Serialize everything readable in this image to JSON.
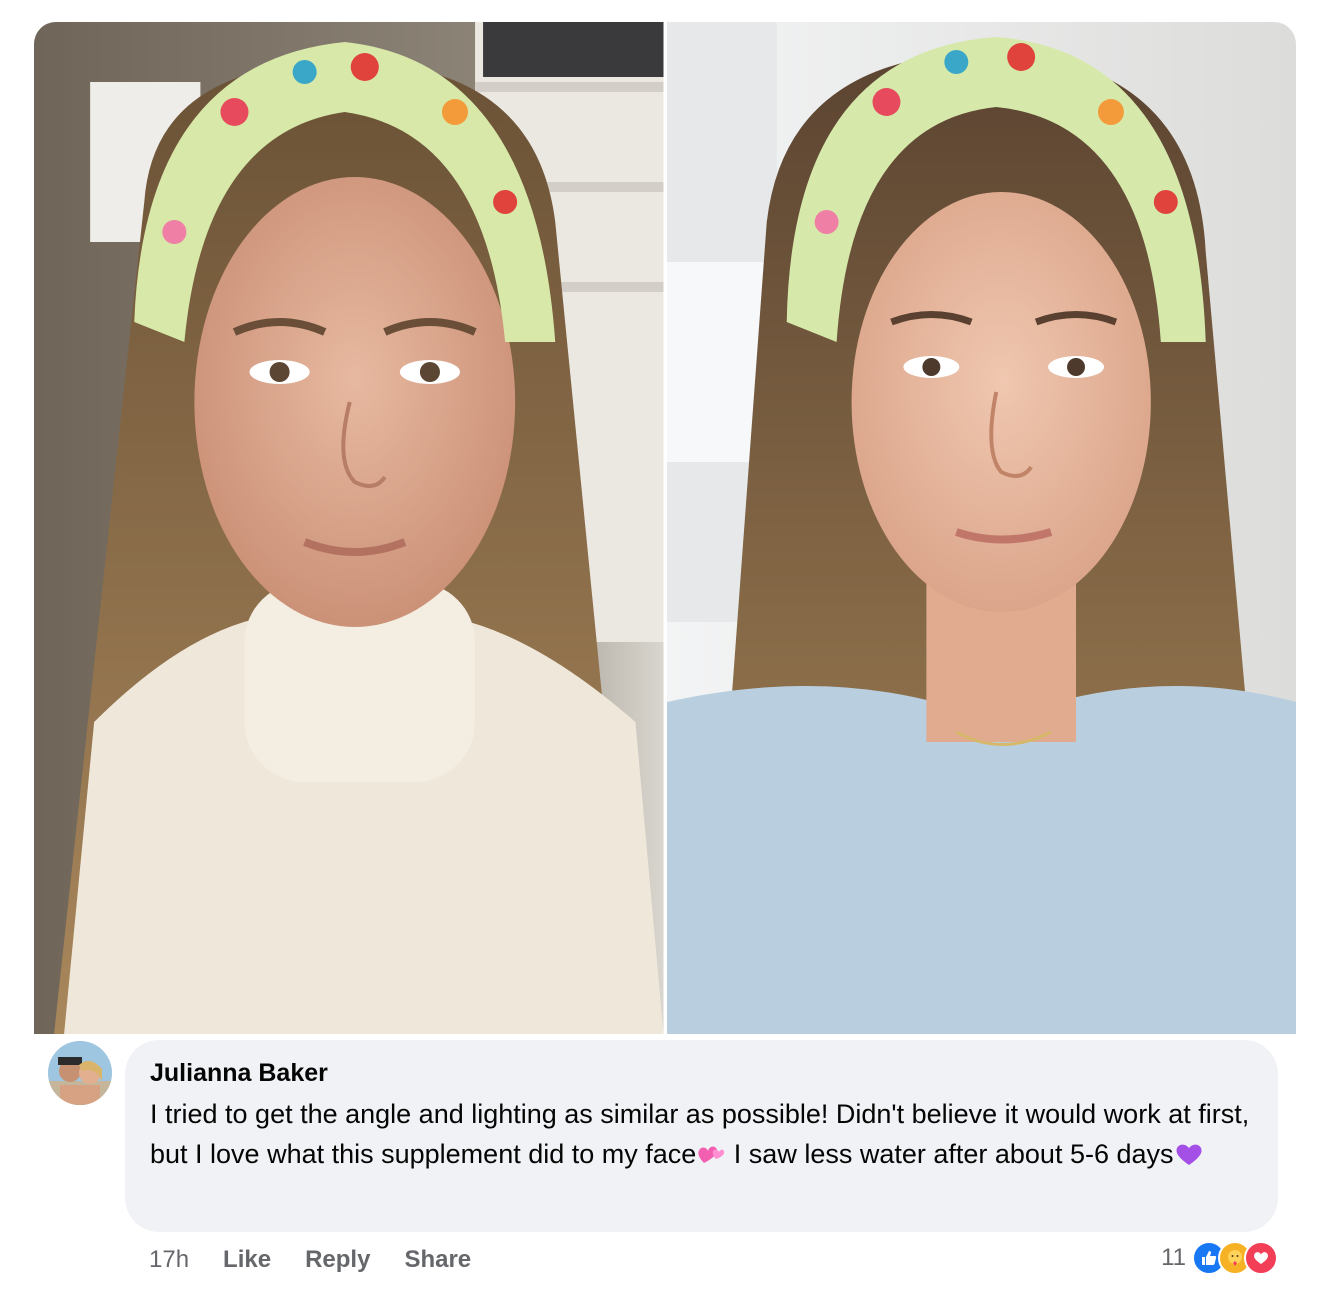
{
  "photos": {
    "before_label": "",
    "after_label": ""
  },
  "comment": {
    "author": "Julianna Baker",
    "text_part1": "I tried to get the angle and lighting as similar as possible! Didn't believe it would work at first, but I love what this supplement did to my face",
    "emoji1": "💞",
    "text_part2": " I saw less water after about 5-6 days",
    "emoji2": "💜"
  },
  "actions": {
    "time": "17h",
    "like": "Like",
    "reply": "Reply",
    "share": "Share"
  },
  "reactions": {
    "count": "11",
    "types": [
      "like-icon",
      "care-icon",
      "love-icon"
    ]
  },
  "colors": {
    "bubble_bg": "#f0f2f5",
    "action_text": "#65676b",
    "like_blue": "#1877f2",
    "care_yellow": "#f7b125",
    "love_red": "#f33e58"
  }
}
